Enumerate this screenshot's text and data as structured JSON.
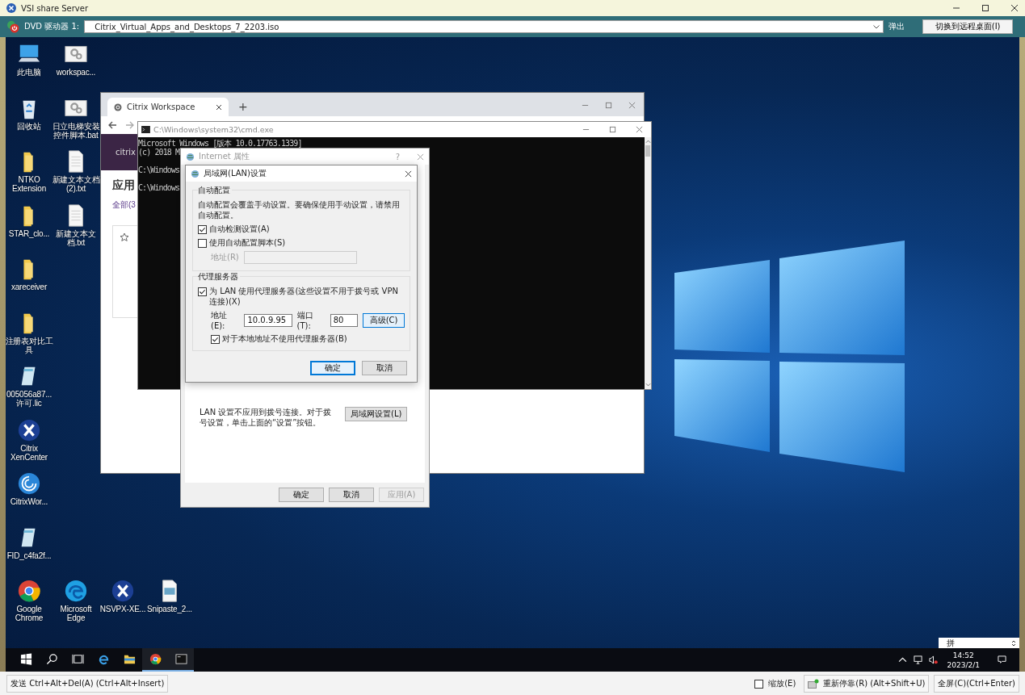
{
  "window": {
    "title": "VSI share Server"
  },
  "toolbar": {
    "drive_label": "DVD 驱动器 1:",
    "iso": "Citrix_Virtual_Apps_and_Desktops_7_2203.iso",
    "eject": "弹出",
    "switch_button": "切换到远程桌面(I)"
  },
  "desktop_icons": [
    {
      "kind": "computer",
      "label": "此电脑"
    },
    {
      "kind": "recycle",
      "label": "回收站"
    },
    {
      "kind": "folder",
      "label": "NTKO Extension"
    },
    {
      "kind": "folder",
      "label": "STAR_clo..."
    },
    {
      "kind": "folder",
      "label": "xareceiver"
    },
    {
      "kind": "folder",
      "label": "注册表对比工具"
    },
    {
      "kind": "license",
      "label": "005056a87... 许可.lic"
    },
    {
      "kind": "xen",
      "label": "Citrix XenCenter"
    },
    {
      "kind": "workspace",
      "label": "CitrixWor..."
    },
    {
      "kind": "license",
      "label": "FID_c4fa2f..."
    },
    {
      "kind": "chrome",
      "label": "Google Chrome"
    },
    {
      "kind": "gear-file",
      "label": "workspac..."
    },
    {
      "kind": "gear-file",
      "label": "日立电梯安装控件脚本.bat"
    },
    {
      "kind": "text-file",
      "label": "新建文本文档(2).txt"
    },
    {
      "kind": "text-file",
      "label": "新建文本文档.txt"
    },
    {
      "kind": "edge",
      "label": "Microsoft Edge"
    },
    {
      "kind": "nsvpx",
      "label": "NSVPX-XE..."
    },
    {
      "kind": "image",
      "label": "Snipaste_2..."
    }
  ],
  "browser": {
    "tab": "Citrix Workspace",
    "new_tab": "+",
    "brand": "citrix",
    "heading": "应用",
    "filter": "全部(3"
  },
  "cmd": {
    "title": "C:\\Windows\\system32\\cmd.exe",
    "lines": [
      "Microsoft Windows [版本 10.0.17763.1339]",
      "(c) 2018 M",
      "C:\\Windows",
      "C:\\Windows"
    ]
  },
  "internet_properties": {
    "title": "Internet 属性",
    "help": "?",
    "lan_note": "LAN 设置不应用到拨号连接。对于拨号设置，单击上面的“设置”按钮。",
    "lan_button": "局域网设置(L)",
    "buttons": [
      {
        "label": "确定",
        "disabled": false
      },
      {
        "label": "取消",
        "disabled": false
      },
      {
        "label": "应用(A)",
        "disabled": true
      }
    ]
  },
  "lan_dialog": {
    "title": "局域网(LAN)设置",
    "auto_config": {
      "legend": "自动配置",
      "note": "自动配置会覆盖手动设置。要确保使用手动设置，请禁用自动配置。",
      "options": [
        {
          "label": "自动检测设置(A)",
          "checked": true
        },
        {
          "label": "使用自动配置脚本(S)",
          "checked": false
        }
      ],
      "script_address": {
        "label": "地址(R)",
        "disabled": true
      }
    },
    "proxy": {
      "legend": "代理服务器",
      "use_proxy": {
        "label": "为 LAN 使用代理服务器(这些设置不用于拨号或 VPN 连接)(X)",
        "checked": true
      },
      "address_label": "地址(E):",
      "address": "10.0.9.95",
      "port_label": "端口(T):",
      "port": "80",
      "advanced_button": "高级(C)",
      "bypass_local": {
        "label": "对于本地地址不使用代理服务器(B)",
        "checked": true
      }
    },
    "buttons": [
      {
        "label": "确定",
        "default": true
      },
      {
        "label": "取消",
        "default": false
      }
    ]
  },
  "taskbar": {
    "items": [
      {
        "kind": "start",
        "running": false
      },
      {
        "kind": "search",
        "running": false
      },
      {
        "kind": "task-view",
        "running": false
      },
      {
        "kind": "ie",
        "running": false
      },
      {
        "kind": "explorer",
        "running": false
      },
      {
        "kind": "chrome",
        "running": true
      },
      {
        "kind": "cmd",
        "running": true
      }
    ],
    "time": "14:52",
    "date": "2023/2/1"
  },
  "ime": {
    "label": "拼"
  },
  "bottom_bar": {
    "send_cad": "发送 Ctrl+Alt+Del(A) (Ctrl+Alt+Insert)",
    "zoom": {
      "label": "缩放(E)",
      "checked": false
    },
    "redock": "重新停靠(R) (Alt+Shift+U)",
    "fullscreen": "全屏(C)(Ctrl+Enter)"
  }
}
